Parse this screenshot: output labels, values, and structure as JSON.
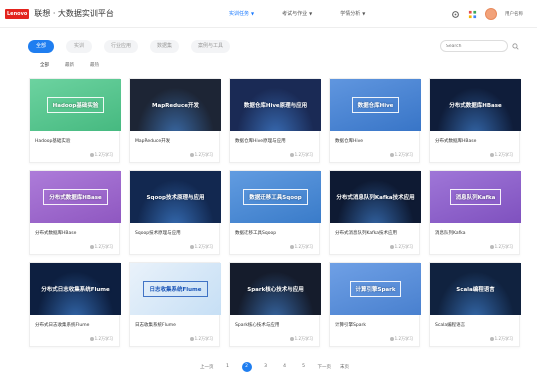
{
  "header": {
    "logo": "Lenovo",
    "title": "联想 · 大数据实训平台",
    "nav": [
      {
        "label": "实训任务",
        "active": true
      },
      {
        "label": "考试与作业",
        "active": false
      },
      {
        "label": "学情分析",
        "active": false
      }
    ],
    "username": "用户名称"
  },
  "toolbar": {
    "categories": [
      {
        "label": "全部",
        "active": true
      },
      {
        "label": "实训",
        "active": false
      },
      {
        "label": "行业应用",
        "active": false
      },
      {
        "label": "数据集",
        "active": false
      },
      {
        "label": "案例与工具",
        "active": false
      }
    ],
    "search_placeholder": "Search"
  },
  "filters": [
    {
      "label": "全部",
      "active": true
    },
    {
      "label": "最新",
      "active": false
    },
    {
      "label": "最热",
      "active": false
    }
  ],
  "cards": [
    {
      "thumb": "Hadoop基础实验",
      "title": "Hadoop基础实验",
      "meta": "1.2万学习",
      "bg": "#4cc98b",
      "style": "boxed"
    },
    {
      "thumb": "MapReduce开发",
      "title": "MapReduce开发",
      "meta": "1.2万学习",
      "bg": "#1d2535",
      "style": "plain"
    },
    {
      "thumb": "数据仓库Hive原理与应用",
      "title": "数据仓库Hive原理与应用",
      "meta": "1.2万学习",
      "bg": "#1a2a55",
      "style": "plain"
    },
    {
      "thumb": "数据仓库Hive",
      "title": "数据仓库Hive",
      "meta": "1.2万学习",
      "bg": "#3d7fd8",
      "style": "boxed"
    },
    {
      "thumb": "分布式数据库HBase",
      "title": "分布式数据库HBase",
      "meta": "1.2万学习",
      "bg": "#0f1d3a",
      "style": "plain"
    },
    {
      "thumb": "分布式数据库HBase",
      "title": "分布式数据库HBase",
      "meta": "1.2万学习",
      "bg": "#9b5fd1",
      "style": "boxed"
    },
    {
      "thumb": "Sqoop技术原理与应用",
      "title": "Sqoop技术原理与应用",
      "meta": "1.2万学习",
      "bg": "#122850",
      "style": "plain"
    },
    {
      "thumb": "数据迁移工具Sqoop",
      "title": "数据迁移工具Sqoop",
      "meta": "1.2万学习",
      "bg": "#3f86da",
      "style": "boxed"
    },
    {
      "thumb": "分布式消息队列Kafka技术应用",
      "title": "分布式消息队列Kafka技术应用",
      "meta": "1.2万学习",
      "bg": "#0e1a33",
      "style": "plain"
    },
    {
      "thumb": "消息队列Kafka",
      "title": "消息队列Kafka",
      "meta": "1.2万学习",
      "bg": "#8a58cf",
      "style": "boxed"
    },
    {
      "thumb": "分布式日志收集系统Flume",
      "title": "分布式日志收集系统Flume",
      "meta": "1.2万学习",
      "bg": "#0d1f40",
      "style": "plain"
    },
    {
      "thumb": "日志收集系统Flume",
      "title": "日志收集系统Flume",
      "meta": "1.2万学习",
      "bg": "#dbe9f7",
      "style": "dark"
    },
    {
      "thumb": "Spark核心技术与应用",
      "title": "Spark核心技术与应用",
      "meta": "1.2万学习",
      "bg": "#151c2c",
      "style": "plain"
    },
    {
      "thumb": "计算引擎Spark",
      "title": "计算引擎Spark",
      "meta": "1.2万学习",
      "bg": "#4f8be0",
      "style": "boxed"
    },
    {
      "thumb": "Scala编程语言",
      "title": "Scala编程语言",
      "meta": "1.2万学习",
      "bg": "#10223f",
      "style": "plain"
    }
  ],
  "pagination": {
    "prev": "上一页",
    "pages": [
      "1",
      "2",
      "3",
      "4",
      "5"
    ],
    "current": "2",
    "next": "下一页",
    "last": "末页"
  },
  "colors": {
    "accent": "#1f7ef0",
    "brand": "#e3231d"
  }
}
